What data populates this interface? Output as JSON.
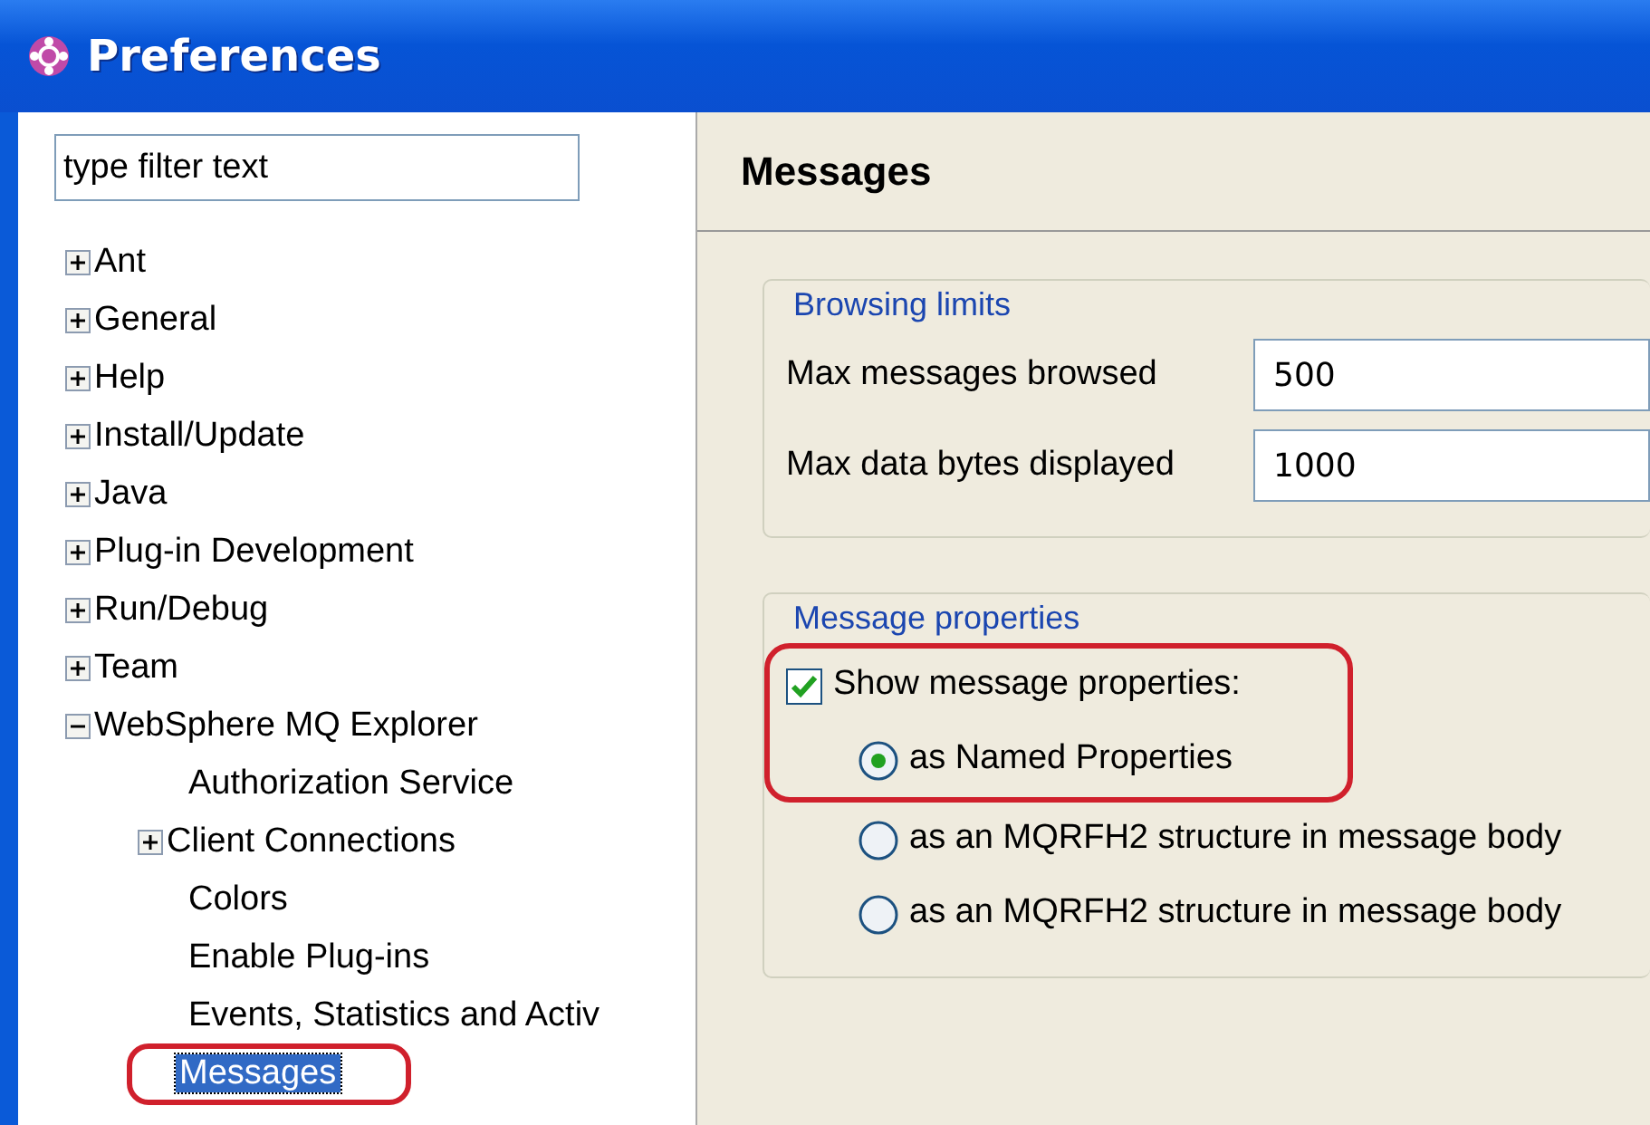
{
  "window": {
    "title": "Preferences"
  },
  "filter": {
    "placeholder": "type filter text"
  },
  "tree": [
    {
      "label": "Ant",
      "expanded": false,
      "selected": false,
      "circled": false
    },
    {
      "label": "General",
      "expanded": false,
      "selected": false,
      "circled": false
    },
    {
      "label": "Help",
      "expanded": false,
      "selected": false,
      "circled": false
    },
    {
      "label": "Install/Update",
      "expanded": false,
      "selected": false,
      "circled": false
    },
    {
      "label": "Java",
      "expanded": false,
      "selected": false,
      "circled": false
    },
    {
      "label": "Plug-in Development",
      "expanded": false,
      "selected": false,
      "circled": false
    },
    {
      "label": "Run/Debug",
      "expanded": false,
      "selected": false,
      "circled": false
    },
    {
      "label": "Team",
      "expanded": false,
      "selected": false,
      "circled": false
    },
    {
      "label": "WebSphere MQ Explorer",
      "expanded": true,
      "selected": false,
      "circled": false,
      "children": [
        {
          "label": "Authorization Service",
          "selected": false,
          "circled": false
        },
        {
          "label": "Client Connections",
          "expanded": false,
          "selected": false,
          "circled": false
        },
        {
          "label": "Colors",
          "selected": false,
          "circled": false
        },
        {
          "label": "Enable Plug-ins",
          "selected": false,
          "circled": false
        },
        {
          "label": "Events, Statistics and Activ",
          "selected": false,
          "circled": false
        },
        {
          "label": "Messages",
          "selected": true,
          "circled": true
        }
      ]
    }
  ],
  "page": {
    "title": "Messages"
  },
  "groups": [
    {
      "title": "Browsing limits",
      "fields": [
        {
          "label": "Max messages browsed",
          "value": "500"
        },
        {
          "label": "Max data bytes displayed",
          "value": "1000"
        }
      ]
    },
    {
      "title": "Message properties",
      "options": [
        {
          "kind": "checkbox",
          "label": "Show message properties:",
          "checked": true,
          "circled": true
        },
        {
          "kind": "radio",
          "label": "as Named Properties",
          "selected": true,
          "circled": true
        },
        {
          "kind": "radio",
          "label": "as an MQRFH2 structure in message body",
          "selected": false,
          "circled": false
        },
        {
          "kind": "radio",
          "label": "as an MQRFH2 structure in message body",
          "selected": false,
          "circled": false
        }
      ]
    }
  ]
}
